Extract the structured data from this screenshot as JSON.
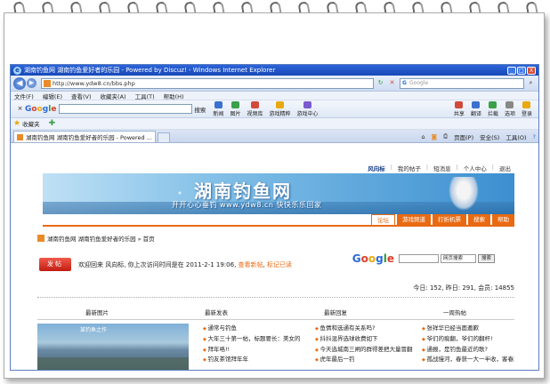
{
  "window": {
    "title": "湖南钓鱼网 湖南钓鱼爱好者的乐园 - Powered by Discuz! - Windows Internet Explorer",
    "minimize": "_",
    "maximize": "□",
    "close": "X"
  },
  "address_bar": {
    "url": "http://www.ydw8.cn/bbs.php",
    "search_placeholder": "Google"
  },
  "menu": [
    "文件(F)",
    "编辑(E)",
    "查看(V)",
    "收藏夹(A)",
    "工具(T)",
    "帮助(H)"
  ],
  "google_toolbar": {
    "search_label": "搜索",
    "items": [
      {
        "label": "新闻",
        "color": "#3b6fd0"
      },
      {
        "label": "图片",
        "color": "#3aa04a"
      },
      {
        "label": "视频库",
        "color": "#d24a3a"
      },
      {
        "label": "游戏精粹",
        "color": "#e8a90e"
      },
      {
        "label": "游戏中心",
        "color": "#7a5ad0"
      }
    ],
    "right_items": [
      "共享",
      "翻译",
      "拦截",
      "选项",
      "登录"
    ]
  },
  "favorites": {
    "label": "收藏夹"
  },
  "tab": {
    "title": "湖南钓鱼网 湖南钓鱼爱好者的乐园 - Powered ...",
    "tools": [
      "页面(P)",
      "安全(S)",
      "工具(O)"
    ]
  },
  "site": {
    "nav": [
      "风向标",
      "我的帖子",
      "短消息",
      "个人中心",
      "退出"
    ],
    "banner_title": "湖南钓鱼网",
    "banner_slogan": "开开心心垂钓 www.ydw8.cn 快快乐乐回家",
    "main_tabs": [
      "论坛",
      "游戏频道",
      "打折机票",
      "搜索",
      "帮助"
    ],
    "breadcrumb": "湖南钓鱼网 湖南钓鱼爱好者的乐园 » 首页",
    "google_select": "网页搜索",
    "google_button": "搜索",
    "post_button": "发帖",
    "welcome_prefix": "欢迎回来 风向标, 你上次访问时间是在 2011-2-1 19:06,",
    "welcome_link1": "查看新帖",
    "welcome_link2": "标记已读",
    "stats": "今日: 152, 昨日: 291, 会员: 14855",
    "sections": [
      "最新图片",
      "最新发表",
      "最新回复",
      "一周热帖"
    ],
    "photo_label": "某钓鱼之作",
    "latest_posts": [
      "通常与钓鱼",
      "大年三十第一帖，标题要长：美女的",
      "拜年咯!!",
      "钓友茶馆拜年年"
    ],
    "latest_replies": [
      "鱼情和选通有关系吗?",
      "抖抖混界选球收费如下",
      "今天选城南三闸的群得差把大量冒翻",
      "虎年最后一钓"
    ],
    "hot_posts": [
      "张祥华已经当面邀歉",
      "爷们的痴翻，爷们的翻杆!",
      "通报，是钓鱼最近的歌?",
      "孤战慢河，春获一大一半收，客春浪"
    ]
  }
}
